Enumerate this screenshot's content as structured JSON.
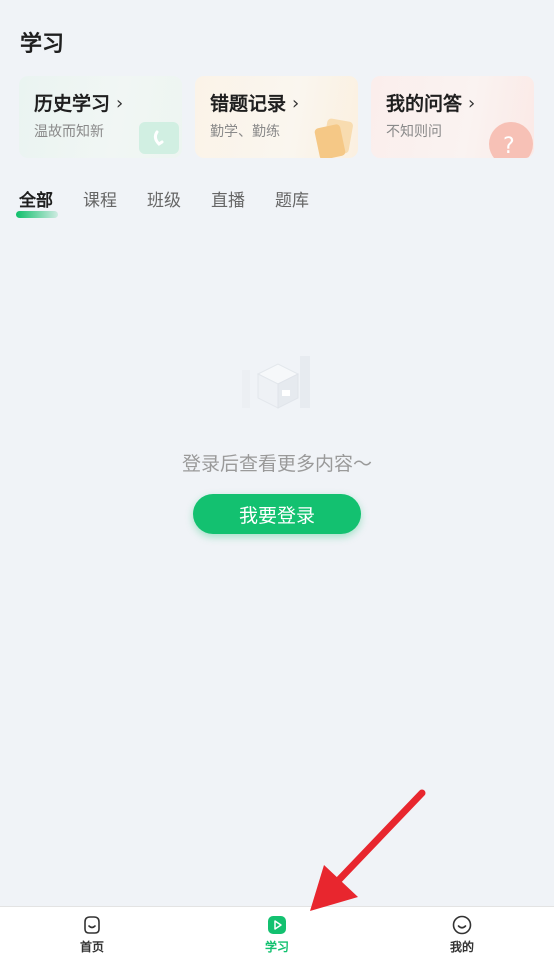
{
  "page": {
    "title": "学习"
  },
  "cards": [
    {
      "title": "历史学习",
      "subtitle": "温故而知新"
    },
    {
      "title": "错题记录",
      "subtitle": "勤学、勤练"
    },
    {
      "title": "我的问答",
      "subtitle": "不知则问"
    }
  ],
  "tabs": [
    "全部",
    "课程",
    "班级",
    "直播",
    "题库"
  ],
  "empty": {
    "message": "登录后查看更多内容～",
    "login_label": "我要登录"
  },
  "bottom_nav": [
    {
      "label": "首页",
      "icon": "home-face-icon"
    },
    {
      "label": "学习",
      "icon": "study-play-icon"
    },
    {
      "label": "我的",
      "icon": "profile-face-icon"
    }
  ],
  "colors": {
    "accent": "#13c170",
    "annotation_arrow": "#e8262e"
  }
}
